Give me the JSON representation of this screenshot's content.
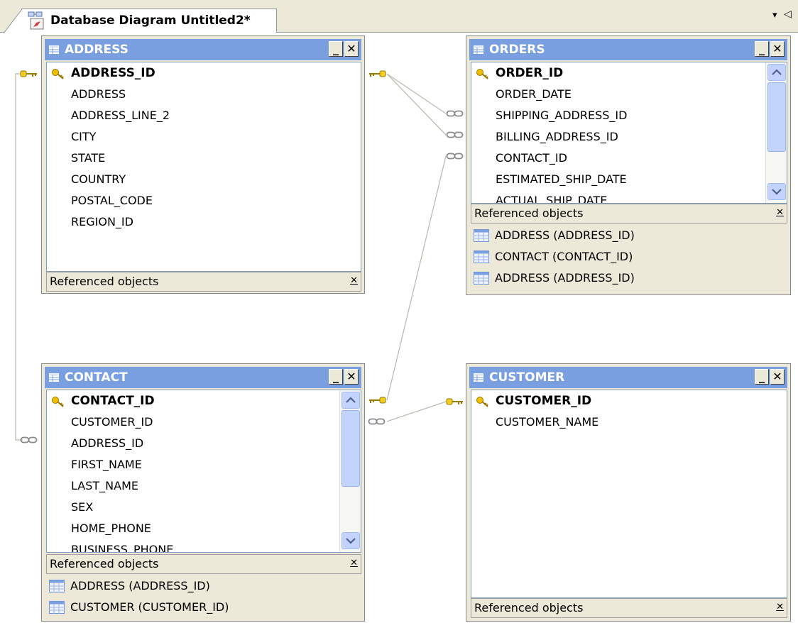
{
  "tab": {
    "title": "Database Diagram Untitled2*",
    "menu_glyph": "▾",
    "scroll_glyph": "◁"
  },
  "window_buttons": {
    "minimize": "_",
    "close": "✕"
  },
  "ref_close_glyph": "✕",
  "tables": {
    "address": {
      "title": "ADDRESS",
      "columns": [
        "ADDRESS_ID",
        "ADDRESS",
        "ADDRESS_LINE_2",
        "CITY",
        "STATE",
        "COUNTRY",
        "POSTAL_CODE",
        "REGION_ID"
      ],
      "referenced_label": "Referenced objects",
      "referenced": []
    },
    "orders": {
      "title": "ORDERS",
      "columns": [
        "ORDER_ID",
        "ORDER_DATE",
        "SHIPPING_ADDRESS_ID",
        "BILLING_ADDRESS_ID",
        "CONTACT_ID",
        "ESTIMATED_SHIP_DATE",
        "ACTUAL_SHIP_DATE"
      ],
      "referenced_label": "Referenced objects",
      "referenced": [
        "ADDRESS (ADDRESS_ID)",
        "CONTACT (CONTACT_ID)",
        "ADDRESS (ADDRESS_ID)"
      ]
    },
    "contact": {
      "title": "CONTACT",
      "columns": [
        "CONTACT_ID",
        "CUSTOMER_ID",
        "ADDRESS_ID",
        "FIRST_NAME",
        "LAST_NAME",
        "SEX",
        "HOME_PHONE",
        "BUSINESS_PHONE"
      ],
      "referenced_label": "Referenced objects",
      "referenced": [
        "ADDRESS (ADDRESS_ID)",
        "CUSTOMER (CUSTOMER_ID)"
      ]
    },
    "customer": {
      "title": "CUSTOMER",
      "columns": [
        "CUSTOMER_ID",
        "CUSTOMER_NAME"
      ],
      "referenced_label": "Referenced objects",
      "referenced": []
    }
  },
  "colors": {
    "titlebar": "#7a9fe0",
    "panel": "#ece9d8",
    "key": "#d8b000",
    "line": "#bdbdb0"
  }
}
